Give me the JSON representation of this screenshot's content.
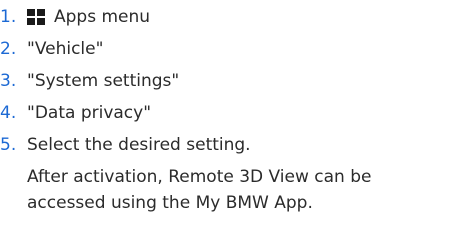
{
  "steps": [
    {
      "number": "1.",
      "icon": "apps-menu-icon",
      "label": "Apps menu"
    },
    {
      "number": "2.",
      "label": "\"Vehicle\""
    },
    {
      "number": "3.",
      "label": "\"System settings\""
    },
    {
      "number": "4.",
      "label": "\"Data privacy\""
    },
    {
      "number": "5.",
      "label": "Select the desired setting."
    }
  ],
  "note": "After activation, Remote 3D View can be accessed using the My BMW App.",
  "colors": {
    "step_number": "#1c69d4",
    "text": "#2b2b2b",
    "icon": "#1a1a1a"
  }
}
